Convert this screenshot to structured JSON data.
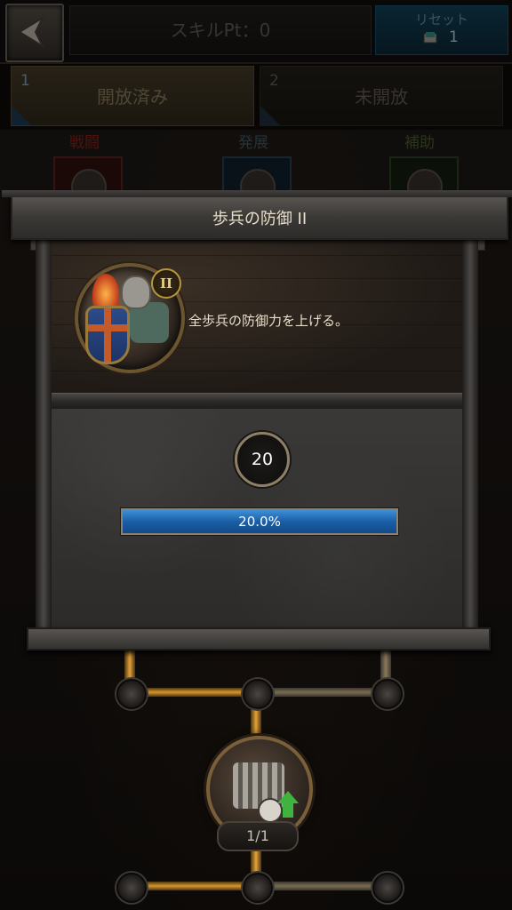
{
  "header": {
    "skill_points_label": "スキルPt：0",
    "reset_label": "リセット",
    "reset_count": "1",
    "back_icon": "back-arrow-icon"
  },
  "tabs": [
    {
      "number": "1",
      "label": "開放済み",
      "active": true
    },
    {
      "number": "2",
      "label": "未開放",
      "active": false
    }
  ],
  "categories": [
    {
      "label": "戦闘",
      "color": "#7a1c17",
      "icon": "combat-emblem-icon"
    },
    {
      "label": "発展",
      "color": "#3b4d57",
      "icon": "develop-emblem-icon"
    },
    {
      "label": "補助",
      "color": "#43502b",
      "icon": "assist-emblem-icon"
    }
  ],
  "popup": {
    "title": "歩兵の防御 II",
    "level_badge": "II",
    "description": "全歩兵の防御力を上げる。",
    "required_level": "20",
    "progress_text": "20.0%",
    "progress_value": 0.2
  },
  "tree": {
    "node_count": "1/1",
    "node_icon": "infantry-troop-icon"
  }
}
